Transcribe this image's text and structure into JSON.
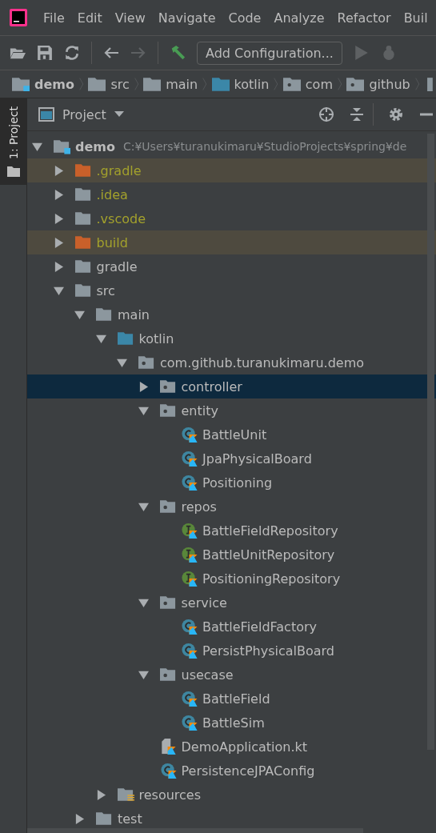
{
  "menu": [
    "File",
    "Edit",
    "View",
    "Navigate",
    "Code",
    "Analyze",
    "Refactor",
    "Buil"
  ],
  "toolbar": {
    "run_config": "Add Configuration..."
  },
  "breadcrumbs": [
    {
      "label": "demo",
      "kind": "module"
    },
    {
      "label": "src",
      "kind": "folder"
    },
    {
      "label": "main",
      "kind": "folder"
    },
    {
      "label": "kotlin",
      "kind": "source"
    },
    {
      "label": "com",
      "kind": "package"
    },
    {
      "label": "github",
      "kind": "package"
    }
  ],
  "side_tab": {
    "label": "1: Project",
    "selected": true
  },
  "panel": {
    "title": "Project"
  },
  "tree": {
    "label": "demo",
    "path": "C:¥Users¥turanukimaru¥StudioProjects¥spring¥de",
    "kind": "module",
    "expanded": true,
    "selected": false,
    "children": [
      {
        "label": ".gradle",
        "kind": "excluded",
        "expanded": false,
        "selected": false
      },
      {
        "label": ".idea",
        "kind": "ignored",
        "expanded": false,
        "selected": false
      },
      {
        "label": ".vscode",
        "kind": "ignored",
        "expanded": false,
        "selected": false
      },
      {
        "label": "build",
        "kind": "excluded",
        "expanded": false,
        "selected": false
      },
      {
        "label": "gradle",
        "kind": "folder",
        "expanded": false,
        "selected": false
      },
      {
        "label": "src",
        "kind": "folder",
        "expanded": true,
        "selected": false,
        "children": [
          {
            "label": "main",
            "kind": "folder",
            "expanded": true,
            "selected": false,
            "children": [
              {
                "label": "kotlin",
                "kind": "source",
                "expanded": true,
                "selected": false,
                "children": [
                  {
                    "label": "com.github.turanukimaru.demo",
                    "kind": "package",
                    "expanded": true,
                    "selected": false,
                    "children": [
                      {
                        "label": "controller",
                        "kind": "package",
                        "expanded": false,
                        "selected": true
                      },
                      {
                        "label": "entity",
                        "kind": "package",
                        "expanded": true,
                        "selected": false,
                        "children": [
                          {
                            "label": "BattleUnit",
                            "kind": "class",
                            "selected": false
                          },
                          {
                            "label": "JpaPhysicalBoard",
                            "kind": "class",
                            "selected": false
                          },
                          {
                            "label": "Positioning",
                            "kind": "class",
                            "selected": false
                          }
                        ]
                      },
                      {
                        "label": "repos",
                        "kind": "package",
                        "expanded": true,
                        "selected": false,
                        "children": [
                          {
                            "label": "BattleFieldRepository",
                            "kind": "interface",
                            "selected": false
                          },
                          {
                            "label": "BattleUnitRepository",
                            "kind": "interface",
                            "selected": false
                          },
                          {
                            "label": "PositioningRepository",
                            "kind": "interface",
                            "selected": false
                          }
                        ]
                      },
                      {
                        "label": "service",
                        "kind": "package",
                        "expanded": true,
                        "selected": false,
                        "children": [
                          {
                            "label": "BattleFieldFactory",
                            "kind": "class",
                            "selected": false
                          },
                          {
                            "label": "PersistPhysicalBoard",
                            "kind": "class",
                            "selected": false
                          }
                        ]
                      },
                      {
                        "label": "usecase",
                        "kind": "package",
                        "expanded": true,
                        "selected": false,
                        "children": [
                          {
                            "label": "BattleField",
                            "kind": "class",
                            "selected": false
                          },
                          {
                            "label": "BattleSim",
                            "kind": "class",
                            "selected": false
                          }
                        ]
                      },
                      {
                        "label": "DemoApplication.kt",
                        "kind": "file",
                        "selected": false
                      },
                      {
                        "label": "PersistenceJPAConfig",
                        "kind": "class",
                        "selected": false
                      }
                    ]
                  }
                ]
              },
              {
                "label": "resources",
                "kind": "resources",
                "expanded": false,
                "selected": false
              }
            ]
          },
          {
            "label": "test",
            "kind": "folder",
            "expanded": false,
            "selected": false
          }
        ]
      }
    ]
  }
}
